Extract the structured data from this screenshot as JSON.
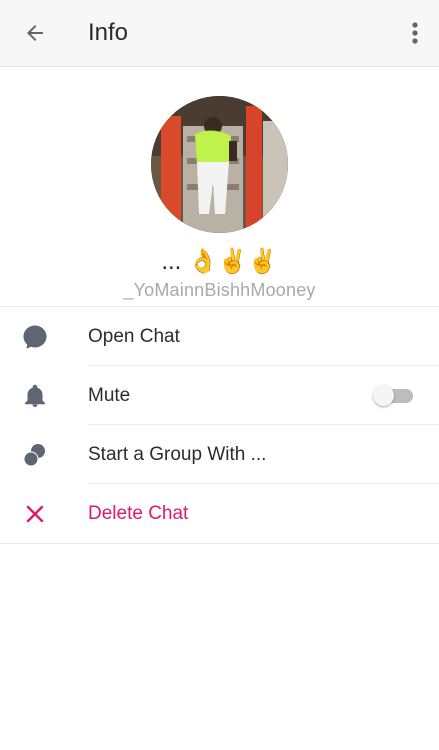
{
  "header": {
    "title": "Info",
    "back_icon": "arrow-left-icon",
    "menu_icon": "more-vertical-icon"
  },
  "profile": {
    "display_name": "... 👌✌️✌️",
    "username": "_YoMainnBishhMooney"
  },
  "actions": [
    {
      "label": "Open Chat",
      "icon": "chat-bubble-icon"
    },
    {
      "label": "Mute",
      "icon": "bell-icon",
      "toggle_on": false
    },
    {
      "label": "Start a Group With ...",
      "icon": "group-icon"
    },
    {
      "label": "Delete Chat",
      "icon": "close-icon"
    }
  ],
  "colors": {
    "icon_gray": "#5f6673",
    "danger": "#e0176f",
    "header_bg": "#f7f7f7"
  }
}
